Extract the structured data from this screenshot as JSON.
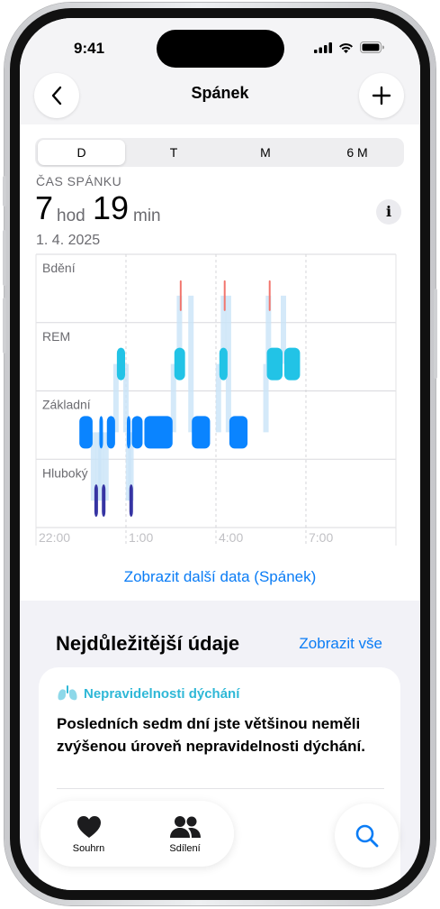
{
  "status_bar": {
    "time": "9:41"
  },
  "nav": {
    "title": "Spánek",
    "back_icon": "chevron-left-icon",
    "add_icon": "plus-icon"
  },
  "segments": {
    "items": [
      "D",
      "T",
      "M",
      "6 M"
    ],
    "selected": "D"
  },
  "summary": {
    "label": "ČAS SPÁNKU",
    "hours": "7",
    "hours_unit": "hod",
    "minutes": "19",
    "minutes_unit": "min",
    "date": "1. 4. 2025"
  },
  "chart_data": {
    "type": "timeline",
    "stages": [
      "Bdění",
      "REM",
      "Základní",
      "Hluboký"
    ],
    "x_ticks": [
      "22:00",
      "1:00",
      "4:00",
      "7:00"
    ],
    "colors": {
      "awake": "#f2766e",
      "rem": "#22c3e6",
      "core": "#0a84ff",
      "deep": "#3634a3"
    },
    "segments": [
      {
        "stage": "Základní",
        "start": "23:25",
        "end": "23:55"
      },
      {
        "stage": "Hluboký",
        "start": "23:55",
        "end": "0:05"
      },
      {
        "stage": "Základní",
        "start": "0:05",
        "end": "0:10"
      },
      {
        "stage": "Hluboký",
        "start": "0:10",
        "end": "0:20"
      },
      {
        "stage": "Základní",
        "start": "0:20",
        "end": "0:40"
      },
      {
        "stage": "REM",
        "start": "0:40",
        "end": "1:00"
      },
      {
        "stage": "Základní",
        "start": "1:00",
        "end": "1:05"
      },
      {
        "stage": "Hluboký",
        "start": "1:05",
        "end": "1:10"
      },
      {
        "stage": "Základní",
        "start": "1:10",
        "end": "1:35"
      },
      {
        "stage": "Základní",
        "start": "1:35",
        "end": "2:35"
      },
      {
        "stage": "REM",
        "start": "2:35",
        "end": "3:00"
      },
      {
        "stage": "Bdění",
        "start": "2:47",
        "end": "2:52"
      },
      {
        "stage": "Základní",
        "start": "3:10",
        "end": "3:50"
      },
      {
        "stage": "REM",
        "start": "4:05",
        "end": "4:25"
      },
      {
        "stage": "Bdění",
        "start": "4:15",
        "end": "4:20"
      },
      {
        "stage": "Základní",
        "start": "4:25",
        "end": "5:05"
      },
      {
        "stage": "REM",
        "start": "5:40",
        "end": "6:15"
      },
      {
        "stage": "Bdění",
        "start": "5:45",
        "end": "5:50"
      },
      {
        "stage": "REM",
        "start": "6:15",
        "end": "6:50"
      }
    ]
  },
  "more_data_link": "Zobrazit další data (Spánek)",
  "highlights": {
    "title": "Nejdůležitější údaje",
    "show_all": "Zobrazit vše",
    "card": {
      "icon": "lungs-icon",
      "category": "Nepravidelnosti dýchání",
      "text": "Posledních sedm dní jste většinou neměli zvýšenou úroveň nepravidelnosti dýchání."
    }
  },
  "tabbar": {
    "items": [
      {
        "label": "Souhrn",
        "icon": "heart-icon"
      },
      {
        "label": "Sdílení",
        "icon": "people-icon"
      }
    ],
    "search_icon": "search-icon"
  }
}
